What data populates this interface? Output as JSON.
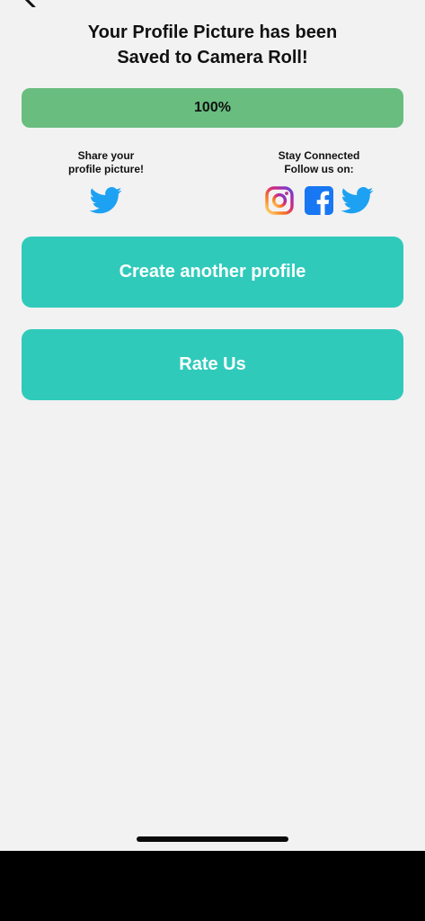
{
  "header": {
    "title_line1": "Your Profile Picture has been",
    "title_line2": "Saved to Camera Roll!"
  },
  "progress": {
    "value": 1.0,
    "label": "100%",
    "color": "#68bd7f"
  },
  "share": {
    "line1": "Share your",
    "line2": "profile picture!",
    "icon": "twitter-icon"
  },
  "follow": {
    "line1": "Stay Connected",
    "line2": "Follow us on:",
    "icons": [
      "instagram-icon",
      "facebook-icon",
      "twitter-icon"
    ]
  },
  "buttons": {
    "create_label": "Create another profile",
    "rate_label": "Rate Us",
    "color": "#30cabb"
  },
  "colors": {
    "twitter": "#1da1f2",
    "facebook": "#1877f2",
    "background": "#f2f2f2"
  }
}
